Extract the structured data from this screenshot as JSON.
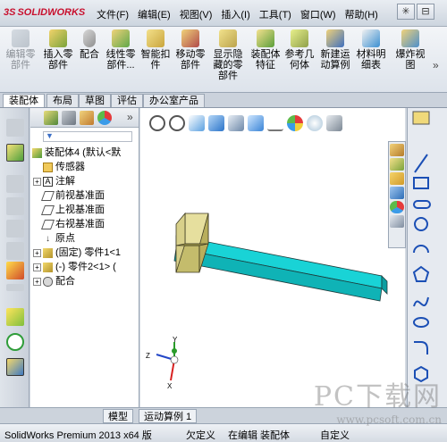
{
  "app": {
    "logo_prefix": "3S",
    "logo_text": "SOLIDWORKS"
  },
  "menu": [
    "文件(F)",
    "编辑(E)",
    "视图(V)",
    "插入(I)",
    "工具(T)",
    "窗口(W)",
    "帮助(H)"
  ],
  "commands": [
    {
      "label": "编辑零\n部件",
      "dim": true
    },
    {
      "label": "插入零\n部件",
      "dim": false
    },
    {
      "label": "配合",
      "dim": false
    },
    {
      "label": "线性零\n部件...",
      "dim": false
    },
    {
      "label": "智能扣\n件",
      "dim": false
    },
    {
      "label": "移动零\n部件",
      "dim": false
    },
    {
      "label": "显示隐\n藏的零\n部件",
      "dim": false
    },
    {
      "label": "装配体\n特征",
      "dim": false
    },
    {
      "label": "参考几\n何体",
      "dim": false
    },
    {
      "label": "新建运\n动算例",
      "dim": false
    },
    {
      "label": "材料明\n细表",
      "dim": false
    },
    {
      "label": "爆炸视\n图",
      "dim": false
    }
  ],
  "tabs": [
    "装配体",
    "布局",
    "草图",
    "评估",
    "办公室产品"
  ],
  "tree": {
    "root": "装配体4 (默认<默",
    "items": [
      {
        "label": "传感器",
        "expand": ""
      },
      {
        "label": "注解",
        "expand": "+"
      },
      {
        "label": "前视基准面",
        "expand": ""
      },
      {
        "label": "上视基准面",
        "expand": ""
      },
      {
        "label": "右视基准面",
        "expand": ""
      },
      {
        "label": "原点",
        "expand": ""
      },
      {
        "label": "(固定) 零件1<1",
        "expand": "+"
      },
      {
        "label": "(-) 零件2<1> (",
        "expand": "+"
      },
      {
        "label": "配合",
        "expand": "+"
      }
    ]
  },
  "triad": {
    "x": "X",
    "y": "Y",
    "z": "Z"
  },
  "bottom_tabs": [
    "模型",
    "运动算例 1"
  ],
  "status": {
    "product": "SolidWorks Premium 2013 x64 版",
    "state1": "欠定义",
    "state2": "在编辑 装配体",
    "custom": "自定义"
  },
  "watermark": {
    "big": "PC下载网",
    "small": "www.pcsoft.com.cn"
  },
  "colors": {
    "part_cyan": "#19d3d6",
    "part_khaki": "#e6df9e",
    "accent_red": "#c8102e"
  }
}
